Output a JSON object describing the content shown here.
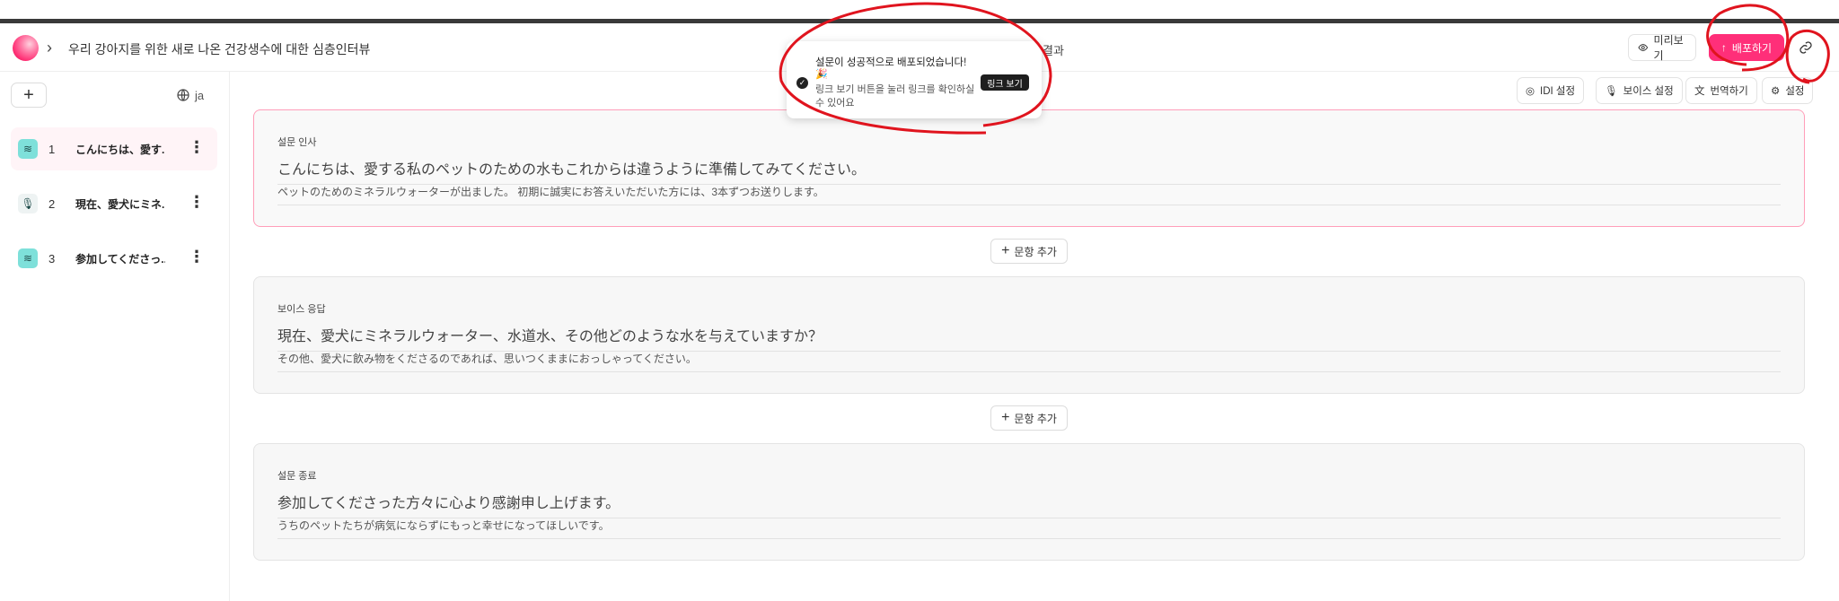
{
  "header": {
    "title": "우리 강아지를 위한 새로 나온 건강생수에 대한 심층인터뷰",
    "nav_result": "결과",
    "preview_label": "미리보기",
    "deploy_label": "배포하기"
  },
  "sidebar": {
    "language": "ja",
    "items": [
      {
        "num": "1",
        "label": "こんにちは、愛す...",
        "icon": "layers-icon"
      },
      {
        "num": "2",
        "label": "現在、愛犬にミネ...",
        "icon": "mic-icon"
      },
      {
        "num": "3",
        "label": "参加してくださっ...",
        "icon": "layers-icon"
      }
    ]
  },
  "toolbar": {
    "idi": "IDI 설정",
    "voice": "보이스 설정",
    "translate": "번역하기",
    "settings": "설정"
  },
  "toast": {
    "title": "설문이 성공적으로 배포되었습니다!",
    "emoji": "🎉",
    "desc": "링크 보기 버튼을 눌러 링크를 확인하실 수 있어요",
    "button": "링크 보기"
  },
  "cards": [
    {
      "label": "설문 인사",
      "title": "こんにちは、愛する私のペットのための水もこれからは違うように準備してみてください。",
      "sub": "ペットのためのミネラルウォーターが出ました。 初期に誠実にお答えいただいた方には、3本ずつお送りします。"
    },
    {
      "label": "보이스 응답",
      "title": "現在、愛犬にミネラルウォーター、水道水、その他どのような水を与えていますか？",
      "sub": "その他、愛犬に飲み物をくださるのであれば、思いつくままにおっしゃってください。"
    },
    {
      "label": "설문 종료",
      "title": "参加してくださった方々に心より感謝申し上げます。",
      "sub": "うちのペットたちが病気にならずにもっと幸せになってほしいです。"
    }
  ],
  "add_question_label": "문항 추가",
  "colors": {
    "accent": "#ff2f79",
    "annotation": "#e0141e"
  }
}
